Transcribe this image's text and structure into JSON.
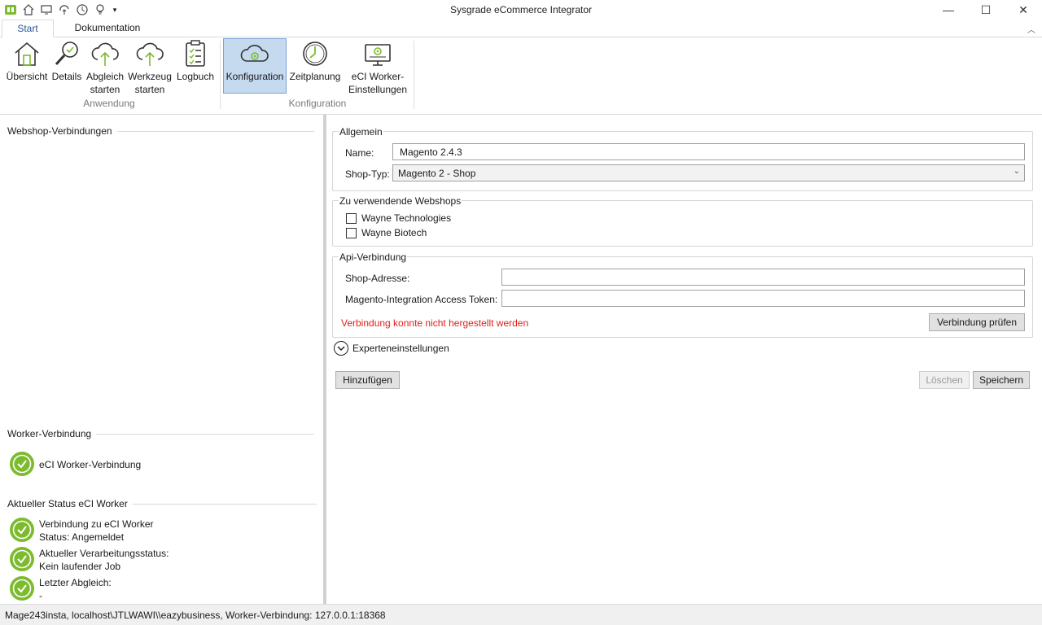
{
  "window": {
    "title": "Sysgrade eCommerce Integrator",
    "minimize": "—",
    "maximize": "☐",
    "close": "✕"
  },
  "tabs": {
    "start": "Start",
    "documentation": "Dokumentation",
    "collapse": "︿"
  },
  "ribbon": {
    "overview": "Übersicht",
    "details": "Details",
    "sync_line1": "Abgleich",
    "sync_line2": "starten",
    "tool_line1": "Werkzeug",
    "tool_line2": "starten",
    "log": "Logbuch",
    "configuration": "Konfiguration",
    "schedule": "Zeitplanung",
    "worker_line1": "eCI Worker-",
    "worker_line2": "Einstellungen",
    "group_app": "Anwendung",
    "group_config": "Konfiguration"
  },
  "left": {
    "webshop_connections": "Webshop-Verbindungen",
    "worker_connection_header": "Worker-Verbindung",
    "worker_connection_item": "eCI Worker-Verbindung",
    "status_header": "Aktueller Status eCI Worker",
    "status_items": [
      {
        "line1": "Verbindung zu eCI Worker",
        "line2": "Status: Angemeldet"
      },
      {
        "line1": "Aktueller Verarbeitungsstatus:",
        "line2": "Kein laufender Job"
      },
      {
        "line1": "Letzter Abgleich:",
        "line2": "-"
      }
    ]
  },
  "general": {
    "header": "Allgemein",
    "name_label": "Name:",
    "name_value": "Magento 2.4.3",
    "shoptype_label": "Shop-Typ:",
    "shoptype_value": "Magento 2 - Shop"
  },
  "webshops": {
    "header": "Zu verwendende Webshops",
    "items": [
      "Wayne Technologies",
      "Wayne Biotech"
    ]
  },
  "api": {
    "header": "Api-Verbindung",
    "address_label": "Shop-Adresse:",
    "address_value": "",
    "token_label": "Magento-Integration Access Token:",
    "token_value": "",
    "error": "Verbindung konnte nicht hergestellt werden",
    "test_button": "Verbindung prüfen"
  },
  "expert": {
    "label": "Experteneinstellungen"
  },
  "actions": {
    "add": "Hinzufügen",
    "delete": "Löschen",
    "save": "Speichern"
  },
  "statusbar": {
    "text": "Mage243insta, localhost\\JTLWAWI\\\\eazybusiness, Worker-Verbindung: 127.0.0.1:18368"
  },
  "colors": {
    "accent": "#2b579a",
    "selected": "#c5d9ef",
    "success": "#7dbb2e",
    "error": "#e0201c"
  }
}
